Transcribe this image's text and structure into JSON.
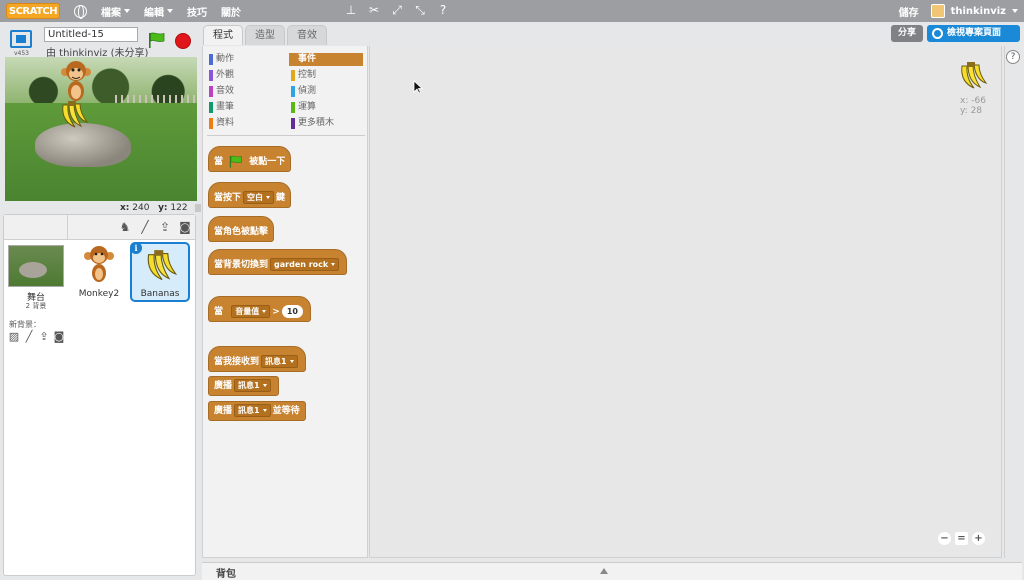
{
  "menubar": {
    "logo": "SCRATCH",
    "menus": [
      "檔案",
      "編輯",
      "技巧",
      "關於"
    ],
    "save": "儲存",
    "username": "thinkinviz"
  },
  "stage_header": {
    "version": "v453",
    "title": "Untitled-15",
    "author": "由 thinkinviz (未分享)"
  },
  "stage_coords": {
    "x_label": "x:",
    "x": "240",
    "y_label": "y:",
    "y": "122"
  },
  "sprites_pane": {
    "stage_label": "舞台",
    "stage_sub": "2 背景",
    "new_backdrop": "新背景：",
    "sprites": [
      {
        "name": "Monkey2"
      },
      {
        "name": "Bananas"
      }
    ]
  },
  "tabs": [
    "程式",
    "造型",
    "音效"
  ],
  "header_buttons": {
    "share": "分享",
    "view": "檢視專案頁面"
  },
  "categories": [
    {
      "label": "動作",
      "color": "#4a6cd4"
    },
    {
      "label": "外觀",
      "color": "#8a55d7"
    },
    {
      "label": "音效",
      "color": "#bb42c3"
    },
    {
      "label": "畫筆",
      "color": "#0e9a6c"
    },
    {
      "label": "資料",
      "color": "#ee7d16"
    },
    {
      "label": "事件",
      "color": "#c88330"
    },
    {
      "label": "控制",
      "color": "#e1a91a"
    },
    {
      "label": "偵測",
      "color": "#2ca5e2"
    },
    {
      "label": "運算",
      "color": "#5cb712"
    },
    {
      "label": "更多積木",
      "color": "#632d99"
    }
  ],
  "blocks": {
    "flag_pre": "當",
    "flag_post": "被點一下",
    "key_pre": "當按下",
    "key_dd": "空白",
    "key_post": "鍵",
    "sprite_click": "當角色被點擊",
    "backdrop_pre": "當背景切換到",
    "backdrop_dd": "garden rock",
    "gt_pre": "當",
    "gt_dd": "音量值",
    "gt_op": ">",
    "gt_val": "10",
    "recv_pre": "當我接收到",
    "recv_dd": "訊息1",
    "bcast_pre": "廣播",
    "bcast_dd": "訊息1",
    "bcastw_pre": "廣播",
    "bcastw_dd": "訊息1",
    "bcastw_post": "並等待"
  },
  "script_area": {
    "x_line": "x: -66",
    "y_line": "y: 28"
  },
  "backpack": {
    "label": "背包"
  },
  "colors": {
    "events": "#c88330",
    "accent_blue": "#1a8ad8",
    "menubar": "#9c9ea2"
  }
}
